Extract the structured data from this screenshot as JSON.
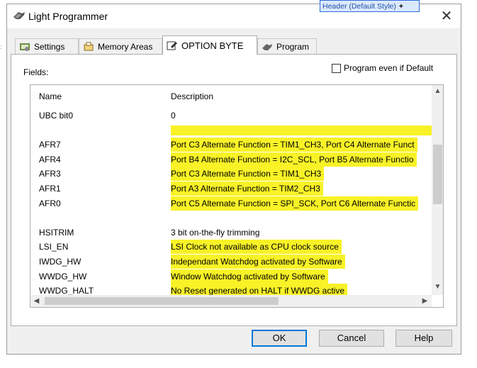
{
  "window": {
    "title": "Light Programmer",
    "close": "✕"
  },
  "tooltip": {
    "text": "Header (Default Style)",
    "plus": "+"
  },
  "tabs": [
    {
      "label": "Settings"
    },
    {
      "label": "Memory Areas"
    },
    {
      "label": "OPTION BYTE"
    },
    {
      "label": "Program"
    }
  ],
  "panel": {
    "fields_label": "Fields:",
    "program_even_label": "Program even if Default",
    "columns": [
      "Name",
      "Description"
    ],
    "rows": [
      {
        "name": "UBC bit0",
        "desc": "0",
        "highlight": false
      },
      {
        "name": "",
        "desc": "",
        "highlight": true
      },
      {
        "name": "AFR7",
        "desc": "Port C3 Alternate Function = TIM1_CH3, Port C4 Alternate Funct",
        "highlight": true
      },
      {
        "name": "AFR4",
        "desc": "Port B4 Alternate Function = I2C_SCL, Port B5 Alternate Functio",
        "highlight": true
      },
      {
        "name": "AFR3",
        "desc": "Port C3 Alternate Function = TIM1_CH3",
        "highlight": true
      },
      {
        "name": "AFR1",
        "desc": "Port A3 Alternate Function = TIM2_CH3",
        "highlight": true
      },
      {
        "name": "AFR0",
        "desc": "Port C5 Alternate Function = SPI_SCK, Port C6 Alternate Functic",
        "highlight": true
      },
      {
        "name": "",
        "desc": "",
        "highlight": false
      },
      {
        "name": "HSITRIM",
        "desc": "3 bit on-the-fly trimming",
        "highlight": false
      },
      {
        "name": "LSI_EN",
        "desc": "LSI Clock not available as CPU clock source",
        "highlight": true
      },
      {
        "name": "IWDG_HW",
        "desc": "Independant Watchdog activated by Software",
        "highlight": true
      },
      {
        "name": "WWDG_HW",
        "desc": "Window Watchdog activated by Software",
        "highlight": true
      },
      {
        "name": "WWDG_HALT",
        "desc": "No Reset generated on HALT if WWDG active",
        "highlight": true
      }
    ]
  },
  "buttons": {
    "ok": "OK",
    "cancel": "Cancel",
    "help": "Help"
  },
  "colors": {
    "highlight": "#f8f227",
    "accent": "#0078d7"
  }
}
